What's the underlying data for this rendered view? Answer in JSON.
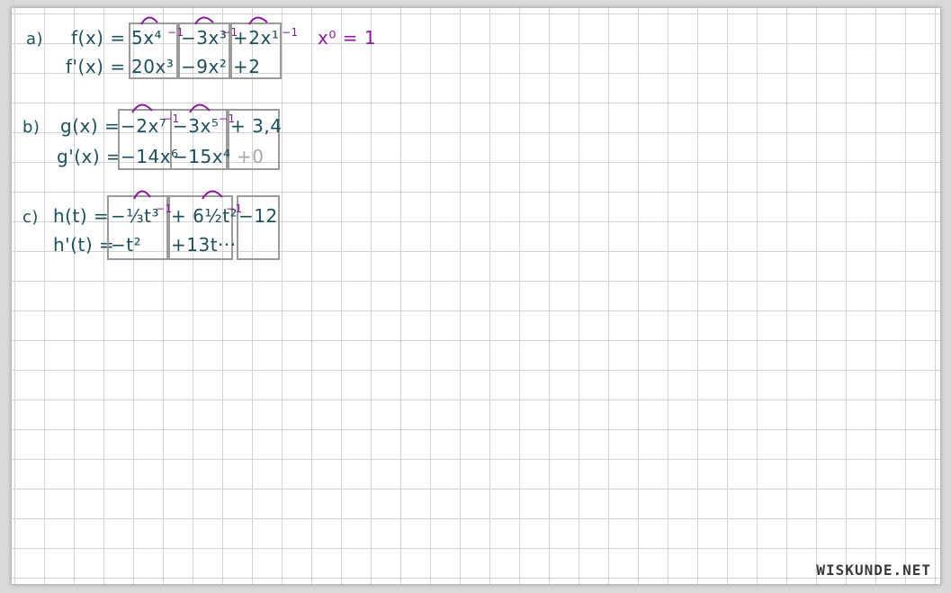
{
  "a": {
    "label": "a)",
    "f_lhs": "f(x) =",
    "f_terms": [
      "5x⁴",
      "−3x³",
      "+2x¹"
    ],
    "f_exp_marks": [
      "−1",
      "−1",
      "−1"
    ],
    "note": "x⁰ = 1",
    "fp_lhs": "f'(x) =",
    "fp_terms": [
      "20x³",
      "−9x²",
      "+2"
    ]
  },
  "b": {
    "label": "b)",
    "g_lhs": "g(x) =",
    "g_terms": [
      "−2x⁷",
      "−3x⁵",
      "+ 3,4"
    ],
    "g_exp_marks": [
      "−1",
      "−1"
    ],
    "gp_lhs": "g'(x) =",
    "gp_terms": [
      "−14x⁶",
      "−15x⁴",
      "+0"
    ]
  },
  "c": {
    "label": "c)",
    "h_lhs": "h(t) =",
    "h_terms": [
      "−⅓t³",
      "+ 6½t²",
      "−12"
    ],
    "h_exp_marks": [
      "−1",
      "−1"
    ],
    "hp_lhs": "h'(t) =",
    "hp_terms": [
      "−t²",
      "+13t···",
      ""
    ]
  },
  "logo": "WISKUNDE.NET",
  "colors": {
    "ink": "#1f4f5a",
    "accent": "#8b1a9c",
    "faded": "#a9a9a9",
    "grid": "#cfd3d6"
  }
}
